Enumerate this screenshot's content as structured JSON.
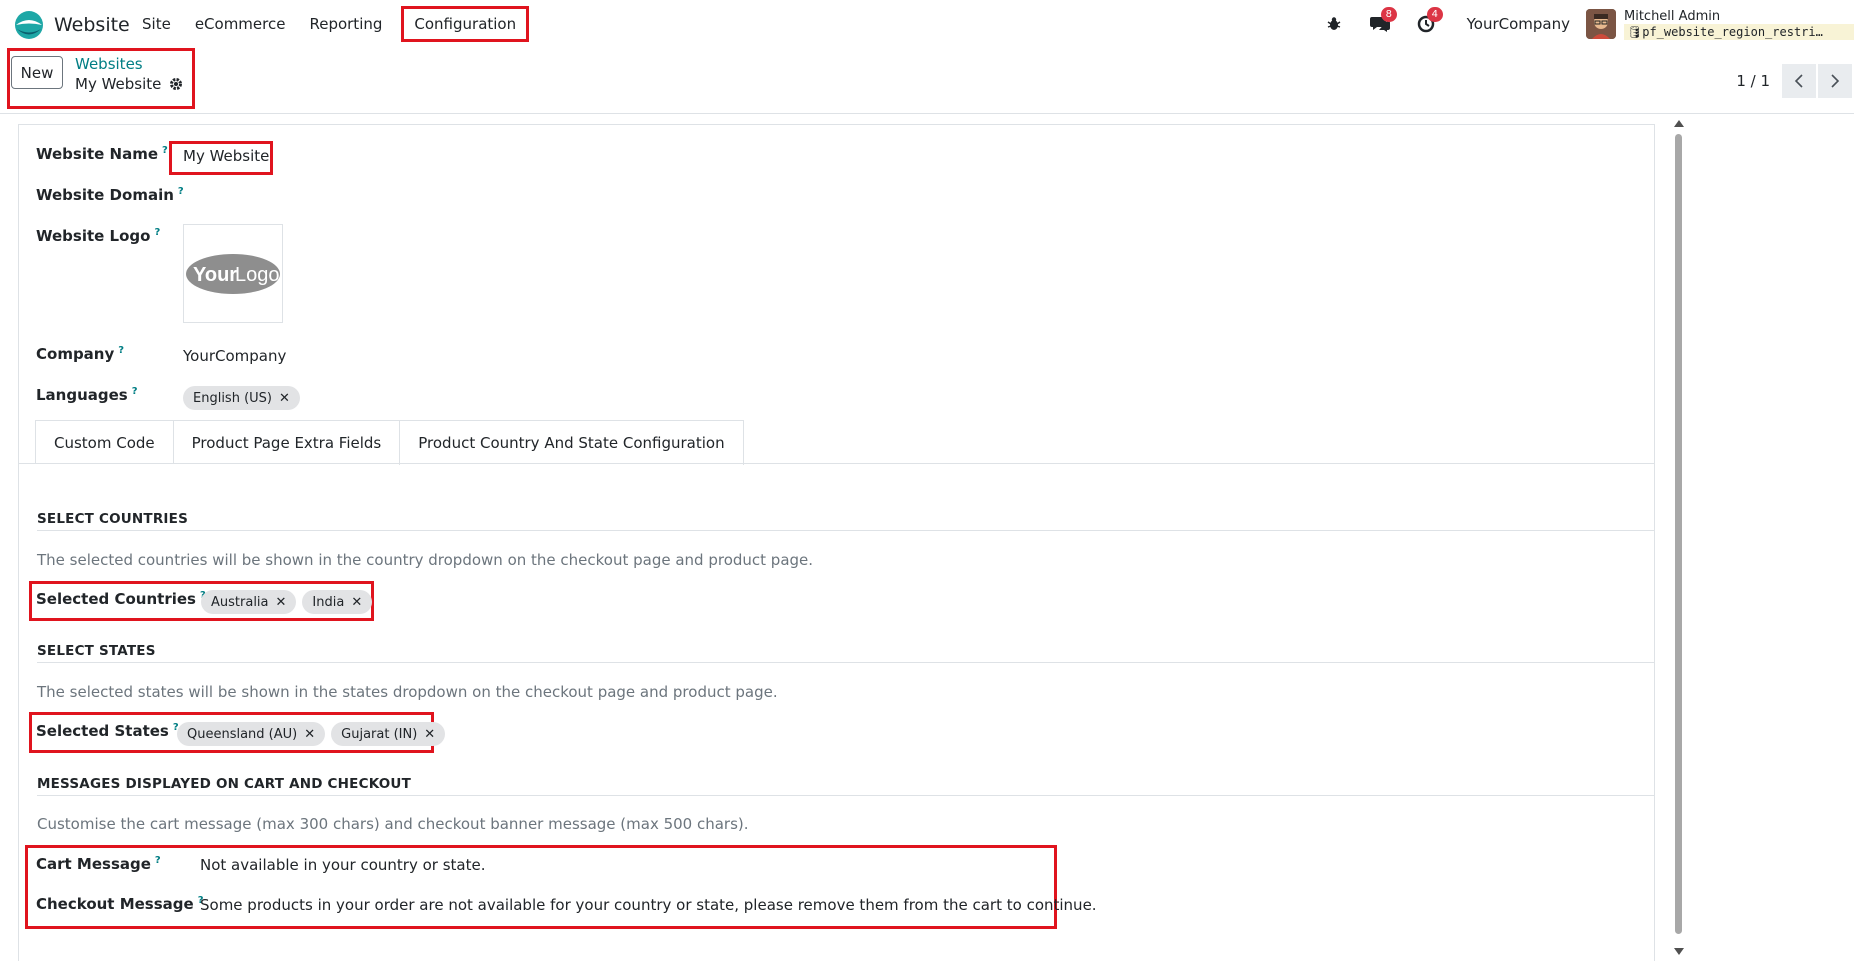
{
  "app": {
    "name": "Website"
  },
  "menu": {
    "items": [
      "Site",
      "eCommerce",
      "Reporting"
    ],
    "highlighted": "Configuration"
  },
  "systray": {
    "messages_count": "8",
    "activities_count": "4",
    "company": "YourCompany",
    "user_name": "Mitchell Admin",
    "database": "pf_website_region_restri…"
  },
  "control_panel": {
    "new_label": "New",
    "breadcrumb_parent": "Websites",
    "breadcrumb_current": "My Website",
    "pager": "1 / 1"
  },
  "form": {
    "website_name": {
      "label": "Website Name",
      "help": "?",
      "value": "My Website"
    },
    "website_domain": {
      "label": "Website Domain",
      "help": "?",
      "value": ""
    },
    "website_logo": {
      "label": "Website Logo",
      "help": "?",
      "logo_text_a": "Your",
      "logo_text_b": "Logo"
    },
    "company": {
      "label": "Company",
      "help": "?",
      "value": "YourCompany"
    },
    "languages": {
      "label": "Languages",
      "help": "?",
      "tags": [
        "English (US)"
      ]
    }
  },
  "tabs": [
    "Custom Code",
    "Product Page Extra Fields",
    "Product Country And State Configuration"
  ],
  "active_tab": "Product Country And State Configuration",
  "countries_section": {
    "title": "SELECT COUNTRIES",
    "description": "The selected countries will be shown in the country dropdown on the checkout page and product page.",
    "label": "Selected Countries",
    "help": "?",
    "tags": [
      "Australia",
      "India"
    ]
  },
  "states_section": {
    "title": "SELECT STATES",
    "description": "The selected states will be shown in the states dropdown on the checkout page and product page.",
    "label": "Selected States",
    "help": "?",
    "tags": [
      "Queensland (AU)",
      "Gujarat (IN)"
    ]
  },
  "messages_section": {
    "title": "MESSAGES DISPLAYED ON CART AND CHECKOUT",
    "description": "Customise the cart message (max 300 chars) and checkout banner message (max 500 chars).",
    "cart_label": "Cart Message",
    "cart_help": "?",
    "cart_value": "Not available in your country or state.",
    "checkout_label": "Checkout Message",
    "checkout_help": "?",
    "checkout_value": "Some products in your order are not available for your country or state, please remove them from the cart to continue."
  },
  "colors": {
    "accent": "#017e84",
    "highlight": "#e0141e",
    "badge": "#dc3545"
  }
}
